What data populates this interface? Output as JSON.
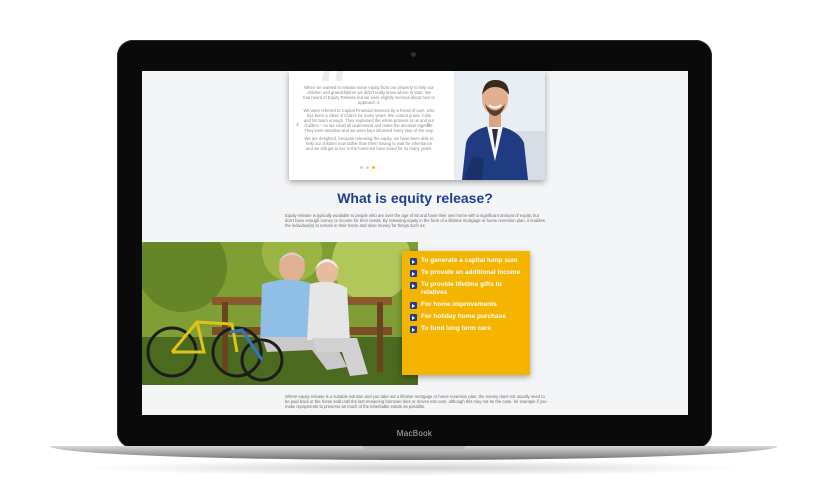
{
  "device": {
    "brand_label": "MacBook"
  },
  "testimonial": {
    "paragraphs": [
      "When we wanted to release some equity from our property to help our children and grandchildren we didn't really know where to start. We had heard of Equity Release but we were slightly nervous about how to approach it.",
      "We were referred to Capital Financial Services by a friend of ours, who has been a client of Colin's for many years. We cannot praise Colin and his team enough. They explained the whole process to us and our children – so we could all understand and make the decision together. They were attentive and we were kept informed every step of the way.",
      "We are delighted, because releasing the equity, we have been able to help our children now rather than them having to wait for inheritance and we still get to live in the home we have loved for so many years."
    ],
    "prev_icon": "‹",
    "next_icon": "›",
    "slide_count": 3,
    "active_slide": 3
  },
  "main": {
    "title": "What is equity release?",
    "intro": "Equity release is typically available to people who are over the age of 55 and have their own home with a significant amount of equity, but don't have enough money or income for their needs. By releasing equity in the form of a lifetime mortgage or home reversion plan, it enables the individual(s) to remain in their home and raise money for things such as:",
    "benefits": [
      "To generate a capital lump sum",
      "To provide an additional income",
      "To provide lifetime gifts to relatives",
      "For home improvements",
      "For holiday home purchase",
      "To fund long term care"
    ],
    "outro": "Where equity release is a suitable solution and you take out a lifetime mortgage or home reversion plan, the money does not usually need to be paid back or the home sold until the last remaining borrower dies or moves into care, although this may not be the case, for example if you make repayments to preserve as much of the inheritable estate as possible."
  },
  "colors": {
    "accent": "#1e3f8f",
    "highlight": "#f5b400"
  }
}
